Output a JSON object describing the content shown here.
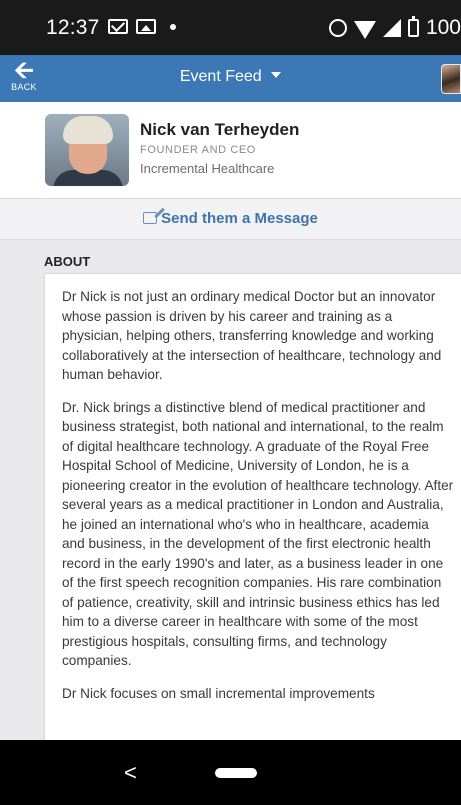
{
  "status_bar": {
    "time": "12:37",
    "battery": "100"
  },
  "app_bar": {
    "back_label": "BACK",
    "title": "Event Feed"
  },
  "profile": {
    "name": "Nick van Terheyden",
    "role": "FOUNDER AND CEO",
    "company": "Incremental Healthcare",
    "message_label": "Send them a Message"
  },
  "about": {
    "heading": "ABOUT",
    "paragraphs": [
      "Dr Nick is not just an ordinary medical Doctor but an innovator whose passion is driven by his career and training as a physician,  helping others, transferring knowledge and working collaboratively at the intersection of healthcare, technology and human behavior.",
      "Dr. Nick brings a distinctive blend of medical practitioner  and business strategist, both national and international, to the realm of  digital healthcare technology. A graduate of the Royal Free Hospital School of  Medicine, University of London, he is a pioneering creator in the evolution of  healthcare technology. After several years as a medical practitioner in London  and Australia, he joined an international who's who in healthcare, academia and business, in the development of the first electronic health record in the early  1990's and later, as a business leader in one of the first speech recognition companies. His rare combination of patience, creativity, skill and intrinsic  business ethics has led him to a diverse career in healthcare with some of the most prestigious hospitals, consulting firms, and technology companies.",
      "Dr Nick focuses on small incremental improvements"
    ]
  },
  "nav_bar": {
    "back_glyph": "<"
  }
}
